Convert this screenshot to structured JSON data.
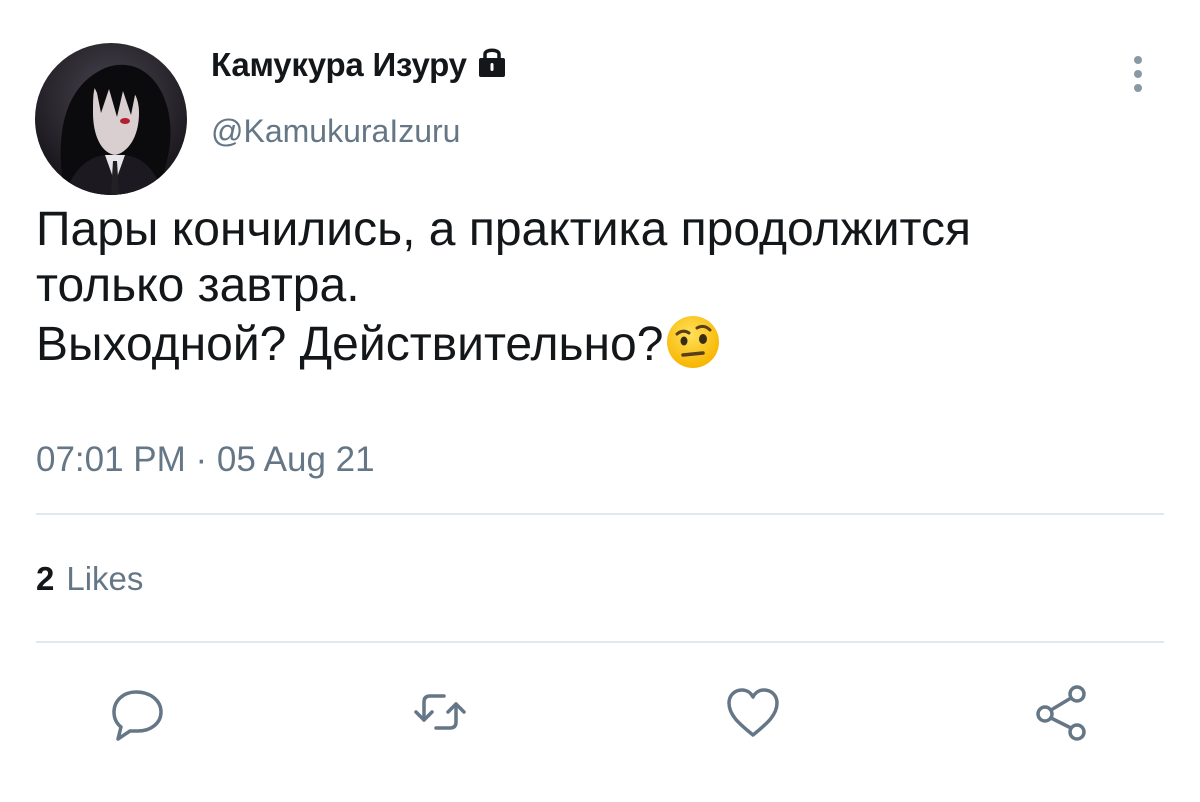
{
  "user": {
    "display_name": "Камукура Изуру",
    "handle": "@KamukuraIzuru",
    "protected_icon": "lock-icon",
    "avatar_icon": "avatar-anime-character"
  },
  "tweet": {
    "lines": [
      "Пары кончились, а практика продолжится",
      "только завтра.",
      "Выходной? Действительно?"
    ],
    "emoji": "face-with-raised-eyebrow",
    "timestamp": "07:01 PM · 05 Aug 21"
  },
  "stats": {
    "likes_count": "2",
    "likes_label": "Likes"
  },
  "actions": {
    "reply_icon": "reply-icon",
    "retweet_icon": "retweet-icon",
    "like_icon": "heart-icon",
    "share_icon": "share-icon"
  },
  "menu_icon": "more-vertical-icon",
  "colors": {
    "text_primary": "#14171a",
    "text_secondary": "#657786",
    "divider": "#e1e8ed",
    "action_icon": "#657786"
  }
}
